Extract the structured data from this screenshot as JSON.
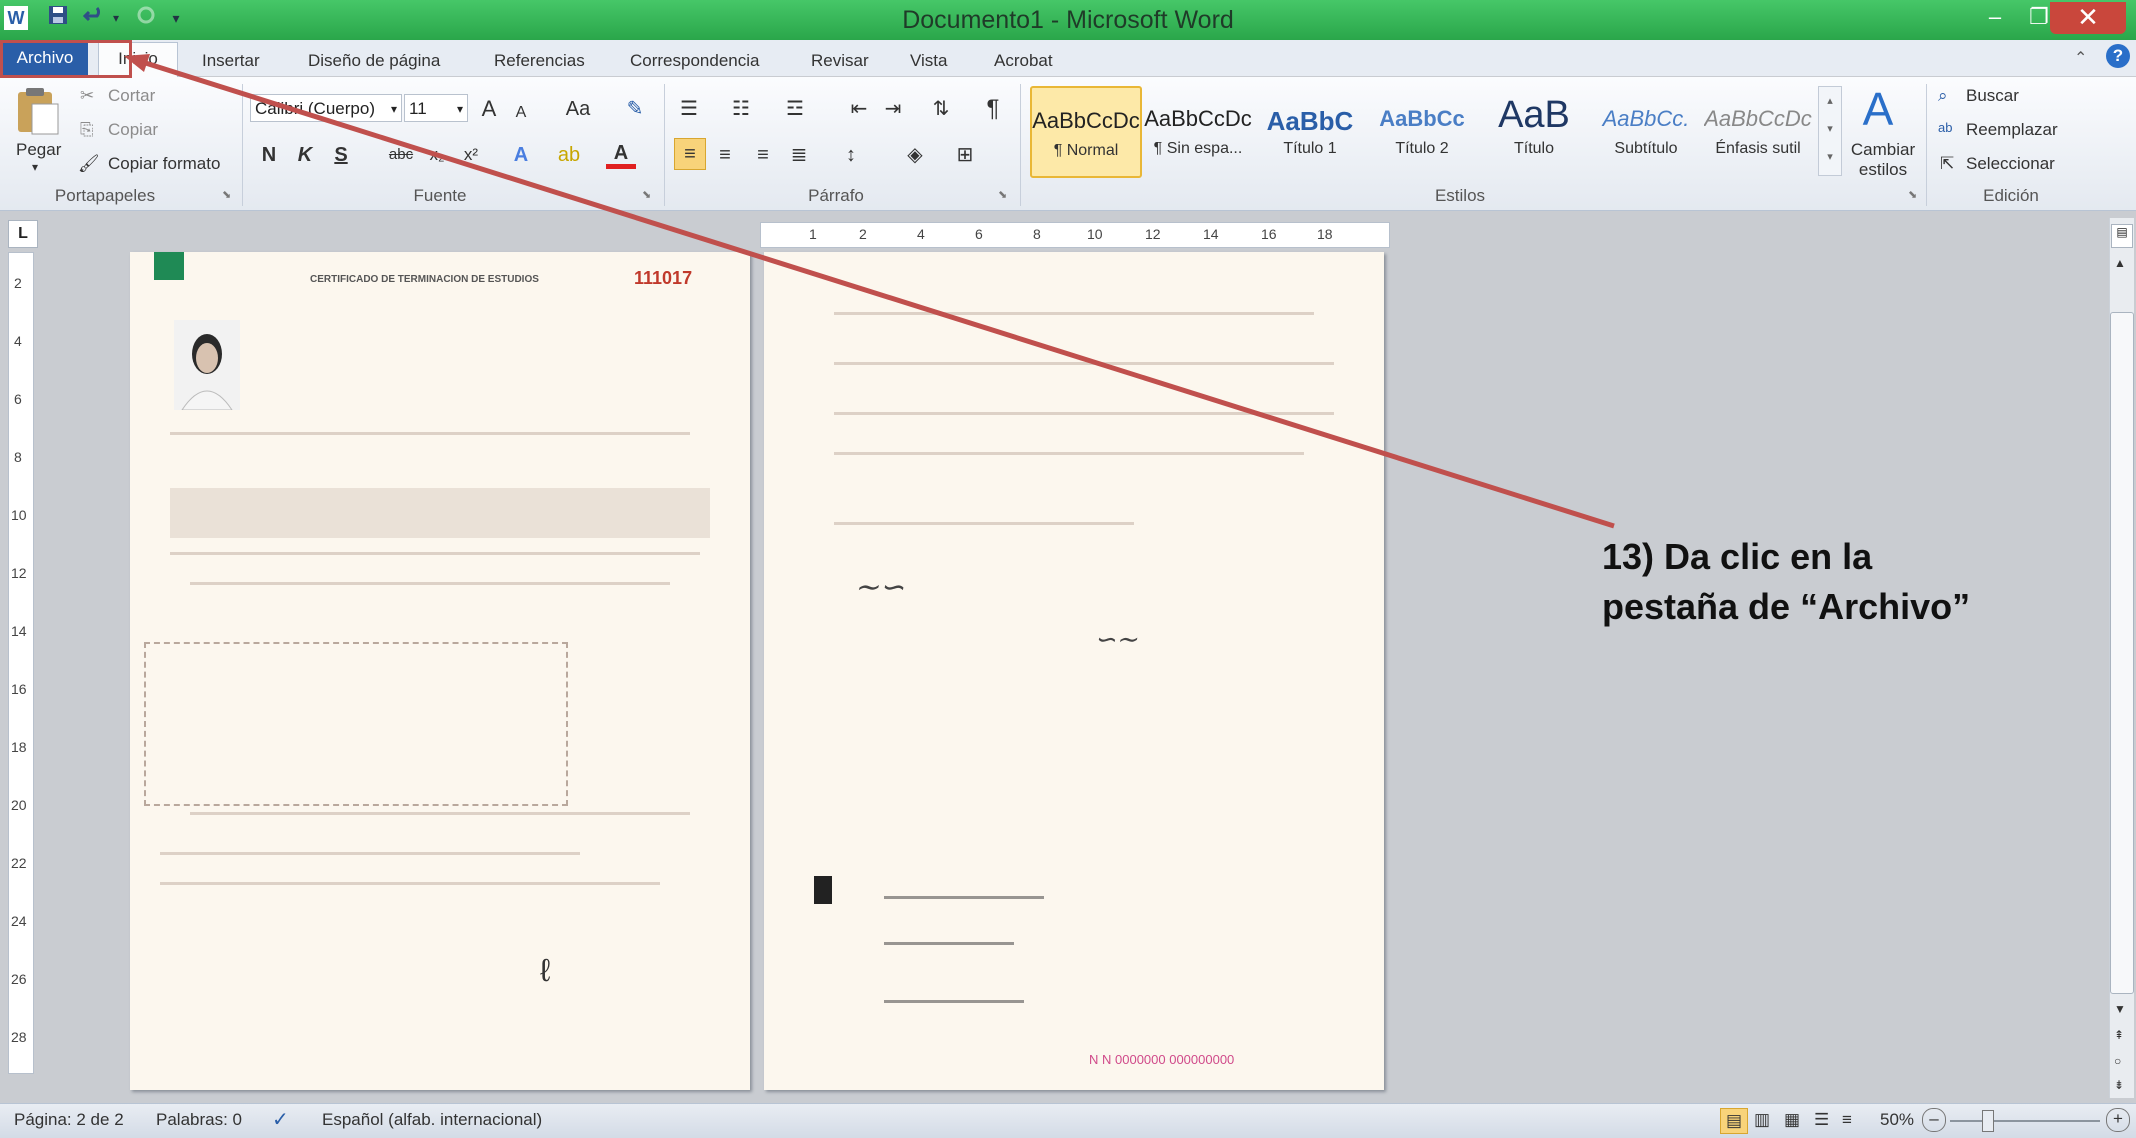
{
  "window": {
    "title": "Documento1  -  Microsoft Word",
    "minimize": "–",
    "restore": "❐",
    "close": "✕"
  },
  "quick_access": {
    "app_icon": "W",
    "save": "save-icon",
    "undo": "undo-icon",
    "redo": "redo-icon"
  },
  "tabs": [
    "Archivo",
    "Inicio",
    "Insertar",
    "Diseño de página",
    "Referencias",
    "Correspondencia",
    "Revisar",
    "Vista",
    "Acrobat"
  ],
  "clipboard": {
    "paste": "Pegar",
    "cut": "Cortar",
    "copy": "Copiar",
    "format_painter": "Copiar formato",
    "group": "Portapapeles"
  },
  "font": {
    "name": "Calibri (Cuerpo)",
    "size": "11",
    "grow": "A",
    "shrink": "A",
    "case": "Aa",
    "bold": "N",
    "italic": "K",
    "underline": "S",
    "strike": "abc",
    "subscript": "x₂",
    "superscript": "x²",
    "group": "Fuente"
  },
  "paragraph": {
    "group": "Párrafo"
  },
  "styles": {
    "items": [
      {
        "sample": "AaBbCcDc",
        "name": "¶ Normal"
      },
      {
        "sample": "AaBbCcDc",
        "name": "¶ Sin espa..."
      },
      {
        "sample": "AaBbC",
        "name": "Título 1"
      },
      {
        "sample": "AaBbCc",
        "name": "Título 2"
      },
      {
        "sample": "AaB",
        "name": "Título"
      },
      {
        "sample": "AaBbCc.",
        "name": "Subtítulo"
      },
      {
        "sample": "AaBbCcDc",
        "name": "Énfasis sutil"
      }
    ],
    "change": "Cambiar estilos",
    "group": "Estilos"
  },
  "editing": {
    "find": "Buscar",
    "replace": "Reemplazar",
    "select": "Seleccionar",
    "group": "Edición"
  },
  "ruler": {
    "h_ticks": [
      "1",
      "2",
      "4",
      "6",
      "8",
      "10",
      "12",
      "14",
      "16",
      "18"
    ],
    "v_ticks": [
      "2",
      "4",
      "6",
      "8",
      "10",
      "12",
      "14",
      "16",
      "18",
      "20",
      "22",
      "24",
      "26",
      "28"
    ]
  },
  "pages": {
    "left": {
      "header": "CERTIFICADO DE TERMINACION DE ESTUDIOS",
      "number": "111017"
    },
    "right": {
      "footer": "N N   0000000 000000000"
    }
  },
  "status": {
    "page": "Página: 2 de 2",
    "words": "Palabras: 0",
    "language": "Español (alfab. internacional)",
    "zoom": "50%"
  },
  "annotation": {
    "text": "13) Da clic en la pestaña de “Archivo”",
    "color": "#c0504d"
  },
  "colors": {
    "titlebar": "#2aa64a",
    "file_tab": "#2a5ea8"
  }
}
